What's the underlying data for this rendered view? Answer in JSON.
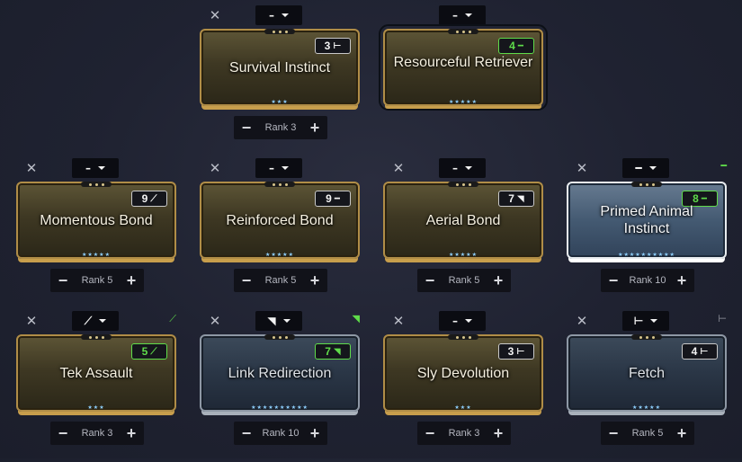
{
  "ui": {
    "remove_glyph": "✕",
    "minus_glyph": "−",
    "plus_glyph": "+",
    "polarity_dash": "–"
  },
  "colors": {
    "match_green": "#5fdc4a",
    "gold_frame": "#b08d47",
    "steel_frame": "#8e98a5",
    "primed_frame": "#e8ecef"
  },
  "mods": [
    {
      "name": "Survival Instinct",
      "drain": "3",
      "polarity_icon": "naramon-polarity-icon",
      "drain_symbol": "⊢",
      "slot_polarity": "–",
      "slot_mark": "",
      "rank": "Rank 3",
      "stars": "★★★",
      "frame": "gold",
      "match": false
    },
    {
      "name": "Resourceful Retriever",
      "drain": "4",
      "polarity_icon": "madurai-polarity-icon",
      "drain_symbol": "━",
      "slot_polarity": "–",
      "slot_mark": "",
      "rank": "",
      "stars": "★★★★★",
      "frame": "gold",
      "match": true
    },
    {
      "name": "Momentous Bond",
      "drain": "9",
      "polarity_icon": "vazarin-polarity-icon",
      "drain_symbol": "⟋",
      "slot_polarity": "–",
      "slot_mark": "",
      "rank": "Rank 5",
      "stars": "★★★★★",
      "frame": "gold",
      "match": false
    },
    {
      "name": "Reinforced Bond",
      "drain": "9",
      "polarity_icon": "madurai-polarity-icon",
      "drain_symbol": "━",
      "slot_polarity": "–",
      "slot_mark": "",
      "rank": "Rank 5",
      "stars": "★★★★★",
      "frame": "gold",
      "match": false
    },
    {
      "name": "Aerial Bond",
      "drain": "7",
      "polarity_icon": "zenurik-polarity-icon",
      "drain_symbol": "◥",
      "slot_polarity": "–",
      "slot_mark": "",
      "rank": "Rank 5",
      "stars": "★★★★★",
      "frame": "gold",
      "match": false
    },
    {
      "name": "Primed Animal Instinct",
      "drain": "8",
      "polarity_icon": "madurai-polarity-icon",
      "drain_symbol": "━",
      "slot_polarity": "━",
      "slot_mark": "━",
      "rank": "Rank 10",
      "stars": "★★★★★★★★★★",
      "frame": "primed",
      "match": true
    },
    {
      "name": "Tek Assault",
      "drain": "5",
      "polarity_icon": "vazarin-polarity-icon",
      "drain_symbol": "⟋",
      "slot_polarity": "⟋",
      "slot_mark": "⟋",
      "rank": "Rank 3",
      "stars": "★★★",
      "frame": "gold",
      "match": true
    },
    {
      "name": "Link Redirection",
      "drain": "7",
      "polarity_icon": "zenurik-polarity-icon",
      "drain_symbol": "◥",
      "slot_polarity": "◥",
      "slot_mark": "◥",
      "rank": "Rank 10",
      "stars": "★★★★★★★★★★",
      "frame": "steel",
      "match": true
    },
    {
      "name": "Sly Devolution",
      "drain": "3",
      "polarity_icon": "naramon-polarity-icon",
      "drain_symbol": "⊢",
      "slot_polarity": "–",
      "slot_mark": "",
      "rank": "Rank 3",
      "stars": "★★★",
      "frame": "gold",
      "match": false
    },
    {
      "name": "Fetch",
      "drain": "4",
      "polarity_icon": "naramon-polarity-icon",
      "drain_symbol": "⊢",
      "slot_polarity": "⊢",
      "slot_mark": "⊢",
      "rank": "Rank 5",
      "stars": "★★★★★",
      "frame": "steel",
      "match": false
    }
  ]
}
